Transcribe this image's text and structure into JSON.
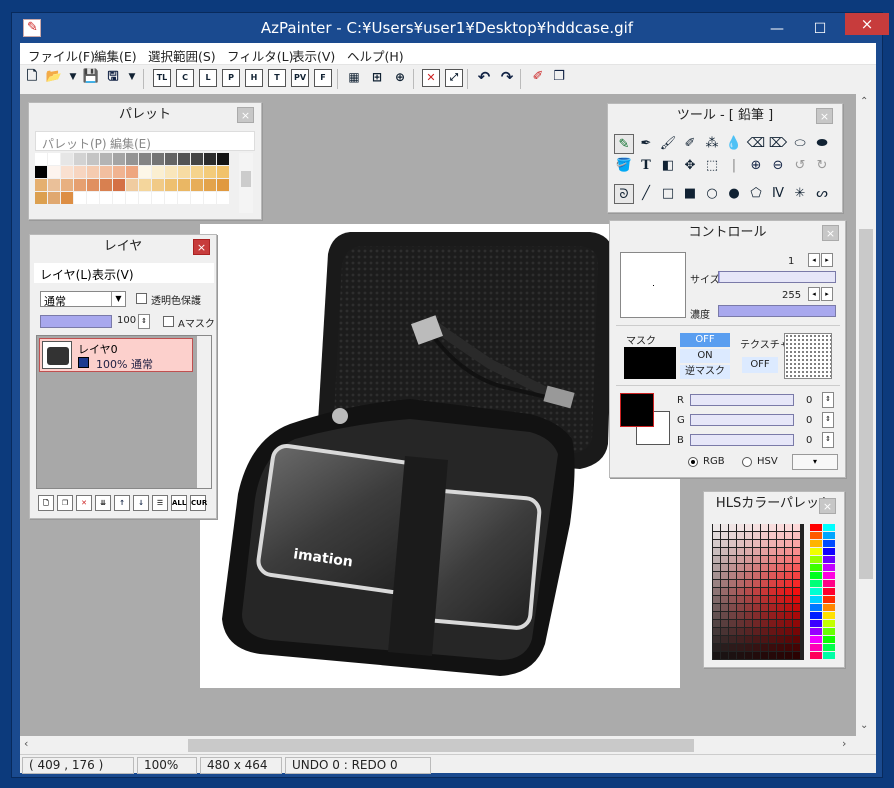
{
  "window": {
    "title": "AzPainter - C:¥Users¥user1¥Desktop¥hddcase.gif",
    "close": "×",
    "minimize": "—",
    "maximize": "☐"
  },
  "menu": [
    "ファイル(F)",
    "編集(E)",
    "選択範囲(S)",
    "フィルタ(L)",
    "表示(V)",
    "ヘルプ(H)"
  ],
  "toolbar": {
    "file": [
      "new-icon",
      "open-icon",
      "open-dropdown-icon",
      "save-icon",
      "save-as-icon",
      "save-dropdown-icon"
    ],
    "panels": [
      "TL",
      "C",
      "L",
      "P",
      "H",
      "T",
      "PV",
      "F"
    ],
    "view": [
      "grid-icon",
      "grid2-icon",
      "crosshair-icon",
      "clear-icon",
      "resize-icon",
      "undo-icon",
      "redo-icon",
      "pen-icon",
      "layer-icon"
    ]
  },
  "palette": {
    "title": "パレット",
    "menu": [
      "パレット(P)",
      "編集(E)"
    ],
    "close": "×",
    "colors": [
      [
        "#ffffff",
        "#ffffff",
        "#e6e6e6",
        "#d2d2d2",
        "#c4c4c4",
        "#b4b4b4",
        "#a4a4a4",
        "#949494",
        "#848484",
        "#747474",
        "#646464",
        "#545454",
        "#444444",
        "#2c2c2c",
        "#141414"
      ],
      [
        "#000000",
        "#fdf4ee",
        "#f9e0d0",
        "#f7d5c0",
        "#f5cbb0",
        "#f2bfa0",
        "#f0b391",
        "#eea680",
        "#fdf7e8",
        "#fbefd1",
        "#f9e6bb",
        "#f7dca3",
        "#f5d38c",
        "#f3cb7a",
        "#f1c26a"
      ],
      [
        "#e5b070",
        "#eac099",
        "#e8b080",
        "#e6a070",
        "#e09060",
        "#d88050",
        "#d47045",
        "#f0cca0",
        "#f4d69c",
        "#f1ca86",
        "#eec070",
        "#eab764",
        "#e7ad58",
        "#e3a34c",
        "#e0993f"
      ],
      [
        "#dca050",
        "#e0a870",
        "#dd8e44",
        "#ffffff",
        "#ffffff",
        "#ffffff",
        "#ffffff",
        "#ffffff",
        "#ffffff",
        "#ffffff",
        "#ffffff",
        "#ffffff",
        "#ffffff",
        "#ffffff",
        "#ffffff"
      ]
    ]
  },
  "layer_panel": {
    "title": "レイヤ",
    "close": "×",
    "menu": [
      "レイヤ(L)",
      "表示(V)"
    ],
    "blend_mode": "通常",
    "protect_alpha_label": "透明色保護",
    "opacity": "100",
    "amask_label": "Aマスク",
    "layers": [
      {
        "name": "レイヤ0",
        "info": "100% 通常"
      }
    ],
    "buttons": [
      "new-layer-icon",
      "copy-layer-icon",
      "delete-layer-icon",
      "merge-layer-icon",
      "up-icon",
      "down-icon",
      "list-icon",
      "ALL",
      "CUR"
    ]
  },
  "tool_panel": {
    "title": "ツール - [ 鉛筆 ]",
    "close": "×"
  },
  "control_panel": {
    "title": "コントロール",
    "close": "×",
    "size_label": "サイズ",
    "size_value": "1",
    "density_label": "濃度",
    "density_value": "255",
    "mask_label": "マスク",
    "mask_buttons": [
      "OFF",
      "ON",
      "逆マスク"
    ],
    "texture_label": "テクスチャ",
    "texture_button": "OFF",
    "r_label": "R",
    "r_value": "0",
    "g_label": "G",
    "g_value": "0",
    "b_label": "B",
    "b_value": "0",
    "rgb_label": "RGB",
    "hsv_label": "HSV",
    "fg_color": "#000000",
    "bg_color": "#ffffff"
  },
  "hls_panel": {
    "title": "HLSカラーパレット",
    "close": "×"
  },
  "image": {
    "brand": "imation"
  },
  "statusbar": {
    "coords": "( 409 , 176 )",
    "zoom": "100%",
    "size": "480 x 464",
    "undo": "UNDO   0 : REDO   0"
  },
  "colors": {
    "titlebar": "#1a4a8f",
    "close_red": "#c73c3c",
    "canvas_bg": "#ababab",
    "accent": "#a8a8ee"
  }
}
